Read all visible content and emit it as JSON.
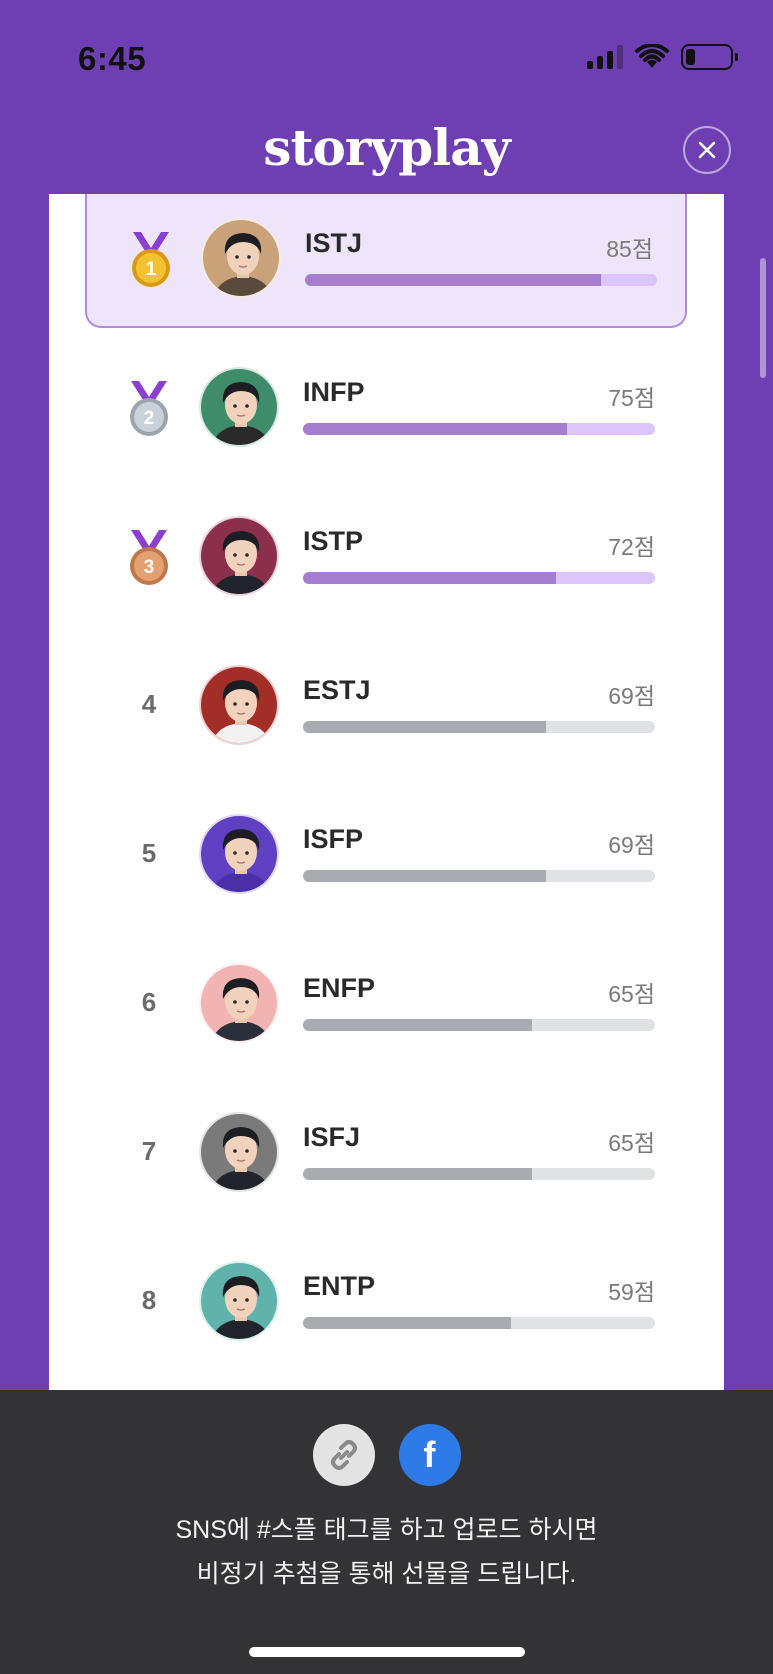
{
  "status": {
    "time": "6:45"
  },
  "header": {
    "logo": "storyplay",
    "close_icon": "close-icon"
  },
  "ranking": [
    {
      "rank": "1",
      "medal": "gold-medal-icon",
      "type": "ISTJ",
      "score": "85점",
      "fill": 0.84,
      "avatar_color": "#c9a27a",
      "shirt_color": "#5a4a3e",
      "bar_style": "purple",
      "highlighted": true
    },
    {
      "rank": "2",
      "medal": "silver-medal-icon",
      "type": "INFP",
      "score": "75점",
      "fill": 0.75,
      "avatar_color": "#3f8c6a",
      "shirt_color": "#2a2a2a",
      "bar_style": "purple",
      "highlighted": false
    },
    {
      "rank": "3",
      "medal": "bronze-medal-icon",
      "type": "ISTP",
      "score": "72점",
      "fill": 0.72,
      "avatar_color": "#8c2f4c",
      "shirt_color": "#22242c",
      "bar_style": "purple",
      "highlighted": false
    },
    {
      "rank": "4",
      "medal": "",
      "type": "ESTJ",
      "score": "69점",
      "fill": 0.69,
      "avatar_color": "#a32d27",
      "shirt_color": "#f2f2f2",
      "bar_style": "gray",
      "highlighted": false
    },
    {
      "rank": "5",
      "medal": "",
      "type": "ISFP",
      "score": "69점",
      "fill": 0.69,
      "avatar_color": "#5f3fc2",
      "shirt_color": "#4a2fa8",
      "bar_style": "gray",
      "highlighted": false
    },
    {
      "rank": "6",
      "medal": "",
      "type": "ENFP",
      "score": "65점",
      "fill": 0.65,
      "avatar_color": "#f2b3b3",
      "shirt_color": "#2b2f3a",
      "bar_style": "gray",
      "highlighted": false
    },
    {
      "rank": "7",
      "medal": "",
      "type": "ISFJ",
      "score": "65점",
      "fill": 0.65,
      "avatar_color": "#7a7a7a",
      "shirt_color": "#22242c",
      "bar_style": "gray",
      "highlighted": false
    },
    {
      "rank": "8",
      "medal": "",
      "type": "ENTP",
      "score": "59점",
      "fill": 0.59,
      "avatar_color": "#5fb3aa",
      "shirt_color": "#22242c",
      "bar_style": "gray",
      "highlighted": false
    }
  ],
  "footer": {
    "link_icon": "link-icon",
    "facebook_icon": "facebook-icon",
    "facebook_glyph": "f",
    "line1": "SNS에 #스플 태그를 하고 업로드 하시면",
    "line2": "비정기 추첨을 통해 선물을 드립니다."
  }
}
